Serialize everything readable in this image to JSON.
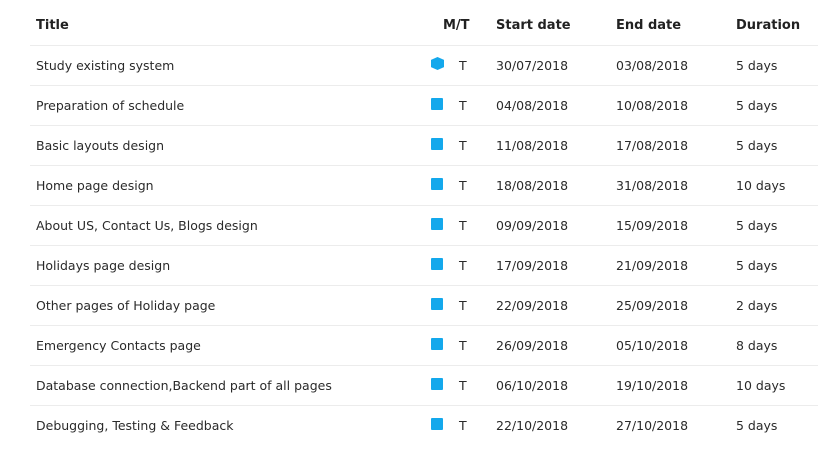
{
  "headers": {
    "title": "Title",
    "mt": "M/T",
    "start": "Start date",
    "end": "End date",
    "duration": "Duration"
  },
  "accent_color": "#13a8ec",
  "rows": [
    {
      "title": "Study existing system",
      "icon": "milestone-hexagon-icon",
      "mt": "T",
      "start": "30/07/2018",
      "end": "03/08/2018",
      "duration": "5 days"
    },
    {
      "title": "Preparation of schedule",
      "icon": "task-square-icon",
      "mt": "T",
      "start": "04/08/2018",
      "end": "10/08/2018",
      "duration": "5 days"
    },
    {
      "title": "Basic layouts design",
      "icon": "task-square-icon",
      "mt": "T",
      "start": "11/08/2018",
      "end": "17/08/2018",
      "duration": "5 days"
    },
    {
      "title": "Home page design",
      "icon": "task-square-icon",
      "mt": "T",
      "start": "18/08/2018",
      "end": "31/08/2018",
      "duration": "10 days"
    },
    {
      "title": "About US, Contact Us, Blogs design",
      "icon": "task-square-icon",
      "mt": "T",
      "start": "09/09/2018",
      "end": "15/09/2018",
      "duration": "5 days"
    },
    {
      "title": "Holidays page design",
      "icon": "task-square-icon",
      "mt": "T",
      "start": "17/09/2018",
      "end": "21/09/2018",
      "duration": "5 days"
    },
    {
      "title": "Other pages of Holiday page",
      "icon": "task-square-icon",
      "mt": "T",
      "start": "22/09/2018",
      "end": "25/09/2018",
      "duration": "2 days"
    },
    {
      "title": "Emergency Contacts page",
      "icon": "task-square-icon",
      "mt": "T",
      "start": "26/09/2018",
      "end": "05/10/2018",
      "duration": "8 days"
    },
    {
      "title": "Database connection,Backend part of all pages",
      "icon": "task-square-icon",
      "mt": "T",
      "start": "06/10/2018",
      "end": "19/10/2018",
      "duration": "10 days"
    },
    {
      "title": "Debugging, Testing & Feedback",
      "icon": "task-square-icon",
      "mt": "T",
      "start": "22/10/2018",
      "end": "27/10/2018",
      "duration": "5 days"
    }
  ]
}
